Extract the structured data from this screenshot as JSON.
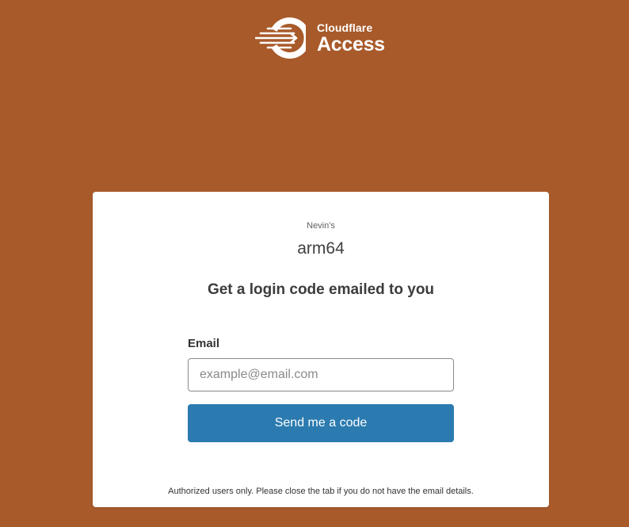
{
  "brand": {
    "logo_icon": "cloudflare-access-logo-icon",
    "company": "Cloudflare",
    "product": "Access"
  },
  "card": {
    "organization": "Nevin's",
    "application": "arm64",
    "heading": "Get a login code emailed to you",
    "email_label": "Email",
    "email_placeholder": "example@email.com",
    "email_value": "",
    "submit_label": "Send me a code",
    "footer_note": "Authorized users only. Please close the tab if you do not have the email details."
  },
  "colors": {
    "background": "#a85a2a",
    "card": "#ffffff",
    "button": "#2b7bb0",
    "button_text": "#ffffff",
    "logo": "#ffffff"
  }
}
